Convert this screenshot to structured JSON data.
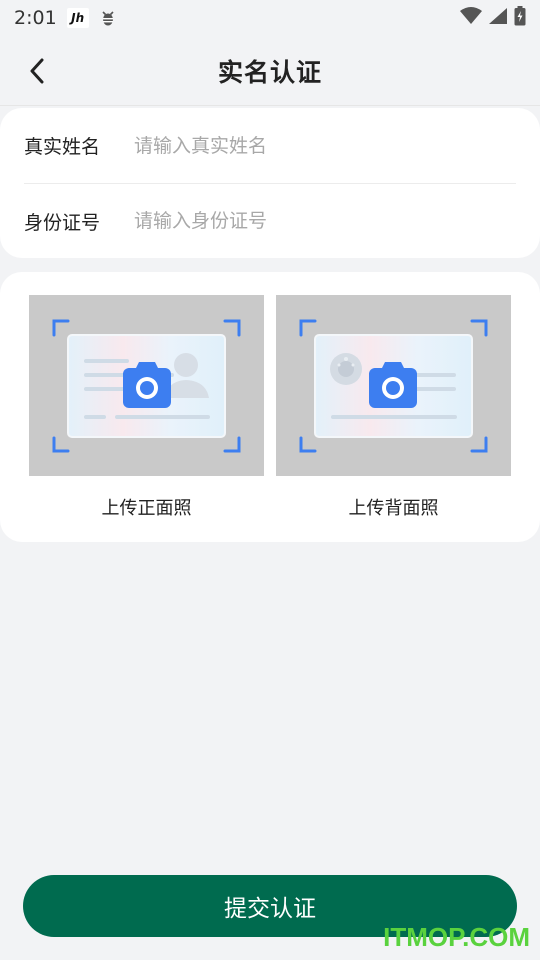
{
  "status_bar": {
    "time": "2:01",
    "app_icon_text": "Jh",
    "icons": [
      "app-icon",
      "bug-icon",
      "wifi-icon",
      "signal-icon",
      "battery-icon"
    ]
  },
  "header": {
    "title": "实名认证",
    "back_icon": "chevron-left-icon"
  },
  "form": {
    "name_label": "真实姓名",
    "name_placeholder": "请输入真实姓名",
    "name_value": "",
    "id_label": "身份证号",
    "id_placeholder": "请输入身份证号",
    "id_value": ""
  },
  "upload": {
    "front_label": "上传正面照",
    "back_label": "上传背面照",
    "icon": "camera-icon"
  },
  "submit_label": "提交认证",
  "watermark": "ITMOP.COM",
  "colors": {
    "primary": "#006b4f",
    "accent_blue": "#3d7ef0",
    "background": "#f2f3f5",
    "placeholder": "#a8a8a8",
    "watermark": "#5ad23e"
  }
}
